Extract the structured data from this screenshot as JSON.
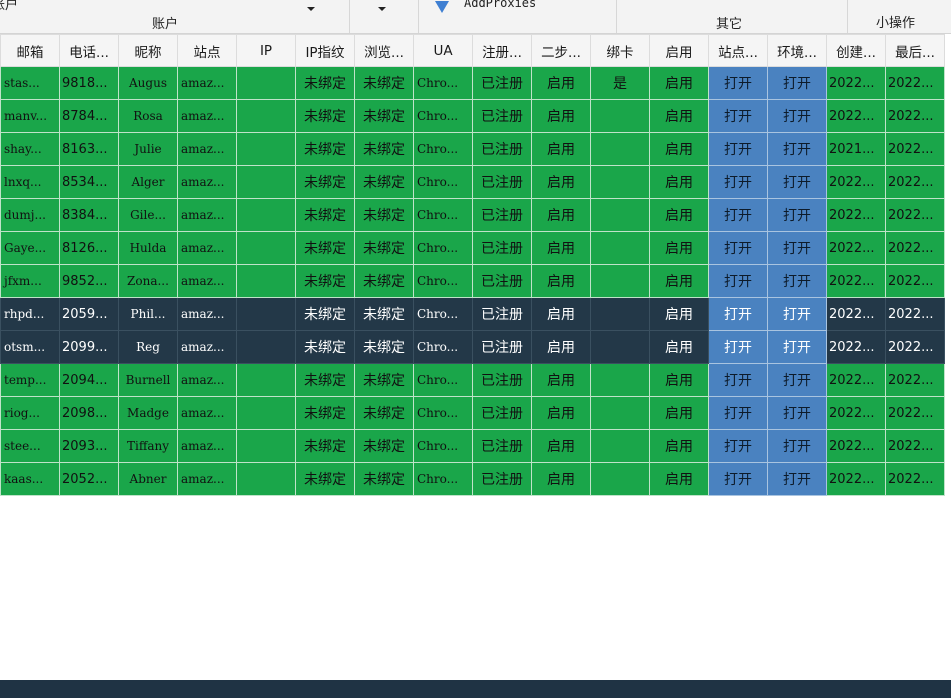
{
  "ribbon": {
    "top_left_partial": "账户",
    "group_account_label": "账户",
    "add_proxies_label": "AddProxies",
    "group_other_label": "其它",
    "group_small_ops_label": "小操作"
  },
  "table": {
    "columns": [
      "邮箱",
      "电话...",
      "昵称",
      "站点",
      "IP",
      "IP指纹",
      "浏览...",
      "UA",
      "注册...",
      "二步...",
      "绑卡",
      "启用",
      "站点...",
      "环境...",
      "创建...",
      "最后..."
    ],
    "rows": [
      {
        "state": "green",
        "email": "stas...",
        "phone": "9818...",
        "nick": "Augus",
        "site": "amaz...",
        "ip": "",
        "ipfp": "未绑定",
        "browser": "未绑定",
        "ua": "Chro...",
        "reg": "已注册",
        "twostep": "启用",
        "card": "是",
        "enabled": "启用",
        "site_open": "打开",
        "env_open": "打开",
        "created": "2022...",
        "last": "2022..."
      },
      {
        "state": "green",
        "email": "manv...",
        "phone": "8784...",
        "nick": "Rosa",
        "site": "amaz...",
        "ip": "",
        "ipfp": "未绑定",
        "browser": "未绑定",
        "ua": "Chro...",
        "reg": "已注册",
        "twostep": "启用",
        "card": "",
        "enabled": "启用",
        "site_open": "打开",
        "env_open": "打开",
        "created": "2022...",
        "last": "2022..."
      },
      {
        "state": "green",
        "email": "shay...",
        "phone": "8163...",
        "nick": "Julie",
        "site": "amaz...",
        "ip": "",
        "ipfp": "未绑定",
        "browser": "未绑定",
        "ua": "Chro...",
        "reg": "已注册",
        "twostep": "启用",
        "card": "",
        "enabled": "启用",
        "site_open": "打开",
        "env_open": "打开",
        "created": "2021...",
        "last": "2022..."
      },
      {
        "state": "green",
        "email": "lnxq...",
        "phone": "8534...",
        "nick": "Alger",
        "site": "amaz...",
        "ip": "",
        "ipfp": "未绑定",
        "browser": "未绑定",
        "ua": "Chro...",
        "reg": "已注册",
        "twostep": "启用",
        "card": "",
        "enabled": "启用",
        "site_open": "打开",
        "env_open": "打开",
        "created": "2022...",
        "last": "2022..."
      },
      {
        "state": "green",
        "email": "dumj...",
        "phone": "8384...",
        "nick": "Gile...",
        "site": "amaz...",
        "ip": "",
        "ipfp": "未绑定",
        "browser": "未绑定",
        "ua": "Chro...",
        "reg": "已注册",
        "twostep": "启用",
        "card": "",
        "enabled": "启用",
        "site_open": "打开",
        "env_open": "打开",
        "created": "2022...",
        "last": "2022..."
      },
      {
        "state": "green",
        "email": "Gaye...",
        "phone": "8126...",
        "nick": "Hulda",
        "site": "amaz...",
        "ip": "",
        "ipfp": "未绑定",
        "browser": "未绑定",
        "ua": "Chro...",
        "reg": "已注册",
        "twostep": "启用",
        "card": "",
        "enabled": "启用",
        "site_open": "打开",
        "env_open": "打开",
        "created": "2022...",
        "last": "2022..."
      },
      {
        "state": "green",
        "email": "jfxm...",
        "phone": "9852...",
        "nick": "Zona...",
        "site": "amaz...",
        "ip": "",
        "ipfp": "未绑定",
        "browser": "未绑定",
        "ua": "Chro...",
        "reg": "已注册",
        "twostep": "启用",
        "card": "",
        "enabled": "启用",
        "site_open": "打开",
        "env_open": "打开",
        "created": "2022...",
        "last": "2022..."
      },
      {
        "state": "dark",
        "email": "rhpd...",
        "phone": "2059...",
        "nick": "Phil...",
        "site": "amaz...",
        "ip": "",
        "ipfp": "未绑定",
        "browser": "未绑定",
        "ua": "Chro...",
        "reg": "已注册",
        "twostep": "启用",
        "card": "",
        "enabled": "启用",
        "site_open": "打开",
        "env_open": "打开",
        "created": "2022...",
        "last": "2022..."
      },
      {
        "state": "dark",
        "email": "otsm...",
        "phone": "2099...",
        "nick": "Reg",
        "site": "amaz...",
        "ip": "",
        "ipfp": "未绑定",
        "browser": "未绑定",
        "ua": "Chro...",
        "reg": "已注册",
        "twostep": "启用",
        "card": "",
        "enabled": "启用",
        "site_open": "打开",
        "env_open": "打开",
        "created": "2022...",
        "last": "2022..."
      },
      {
        "state": "green",
        "email": "temp...",
        "phone": "2094...",
        "nick": "Burnell",
        "site": "amaz...",
        "ip": "",
        "ipfp": "未绑定",
        "browser": "未绑定",
        "ua": "Chro...",
        "reg": "已注册",
        "twostep": "启用",
        "card": "",
        "enabled": "启用",
        "site_open": "打开",
        "env_open": "打开",
        "created": "2022...",
        "last": "2022..."
      },
      {
        "state": "green",
        "email": "riog...",
        "phone": "2098...",
        "nick": "Madge",
        "site": "amaz...",
        "ip": "",
        "ipfp": "未绑定",
        "browser": "未绑定",
        "ua": "Chro...",
        "reg": "已注册",
        "twostep": "启用",
        "card": "",
        "enabled": "启用",
        "site_open": "打开",
        "env_open": "打开",
        "created": "2022...",
        "last": "2022..."
      },
      {
        "state": "green",
        "email": "stee...",
        "phone": "2093...",
        "nick": "Tiffany",
        "site": "amaz...",
        "ip": "",
        "ipfp": "未绑定",
        "browser": "未绑定",
        "ua": "Chro...",
        "reg": "已注册",
        "twostep": "启用",
        "card": "",
        "enabled": "启用",
        "site_open": "打开",
        "env_open": "打开",
        "created": "2022...",
        "last": "2022..."
      },
      {
        "state": "green",
        "email": "kaas...",
        "phone": "2052...",
        "nick": "Abner",
        "site": "amaz...",
        "ip": "",
        "ipfp": "未绑定",
        "browser": "未绑定",
        "ua": "Chro...",
        "reg": "已注册",
        "twostep": "启用",
        "card": "",
        "enabled": "启用",
        "site_open": "打开",
        "env_open": "打开",
        "created": "2022...",
        "last": "2022..."
      }
    ]
  },
  "colors": {
    "row_green": "#1aa64a",
    "row_selected": "#233848",
    "open_button": "#4a82c0",
    "statusbar": "#1f3344"
  }
}
